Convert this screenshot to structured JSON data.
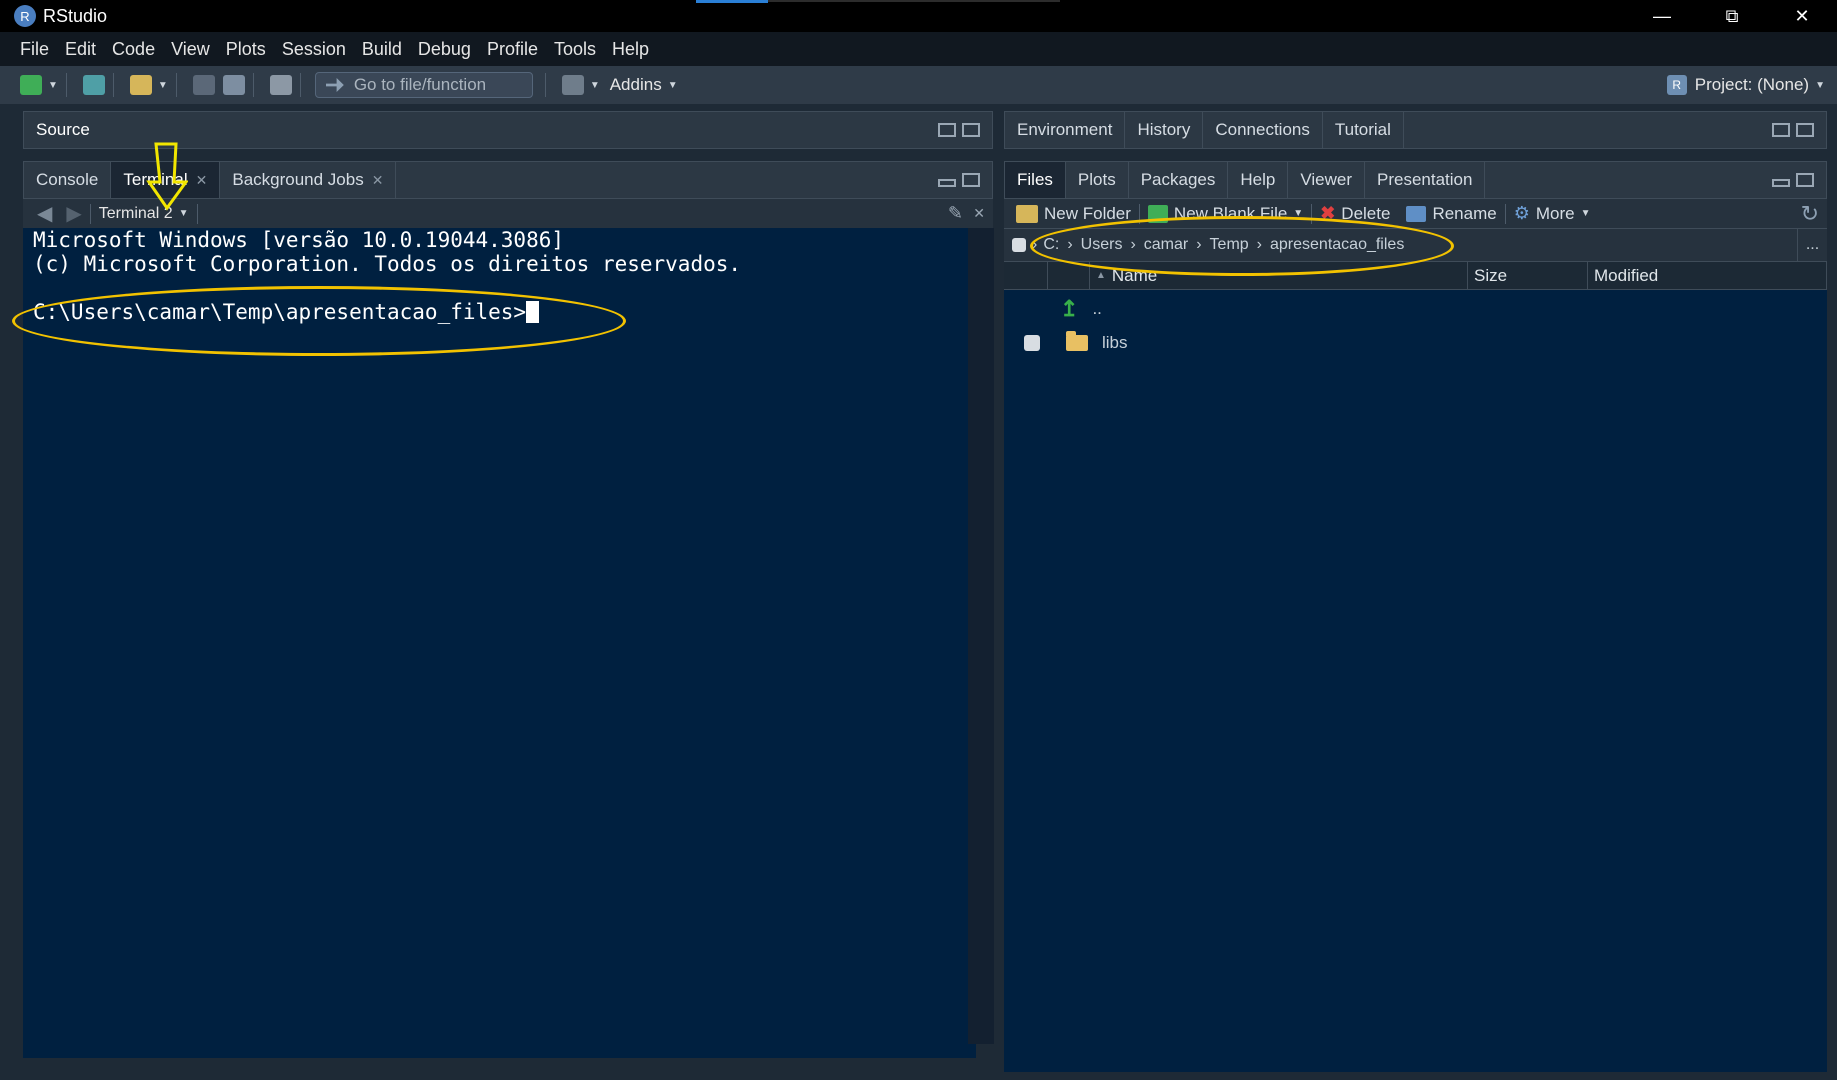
{
  "window": {
    "title": "RStudio",
    "logo_letter": "R"
  },
  "menu": [
    "File",
    "Edit",
    "Code",
    "View",
    "Plots",
    "Session",
    "Build",
    "Debug",
    "Profile",
    "Tools",
    "Help"
  ],
  "toolbar": {
    "goto_placeholder": "Go to file/function",
    "addins_label": "Addins",
    "project_label": "Project: (None)"
  },
  "source_pane": {
    "title": "Source"
  },
  "left_tabs": [
    {
      "label": "Console",
      "active": false
    },
    {
      "label": "Terminal",
      "active": true,
      "closable": true
    },
    {
      "label": "Background Jobs",
      "active": false,
      "closable": true
    }
  ],
  "terminal": {
    "selector_label": "Terminal 2",
    "lines": [
      "Microsoft Windows [versão 10.0.19044.3086]",
      "(c) Microsoft Corporation. Todos os direitos reservados.",
      ""
    ],
    "prompt": "C:\\Users\\camar\\Temp\\apresentacao_files>"
  },
  "right_top_tabs": [
    "Environment",
    "History",
    "Connections",
    "Tutorial"
  ],
  "right_bottom_tabs": [
    {
      "label": "Files",
      "active": true
    },
    {
      "label": "Plots",
      "active": false
    },
    {
      "label": "Packages",
      "active": false
    },
    {
      "label": "Help",
      "active": false
    },
    {
      "label": "Viewer",
      "active": false
    },
    {
      "label": "Presentation",
      "active": false
    }
  ],
  "files_toolbar": {
    "new_folder": "New Folder",
    "new_blank_file": "New Blank File",
    "delete": "Delete",
    "rename": "Rename",
    "more": "More"
  },
  "breadcrumb": [
    "C:",
    "Users",
    "camar",
    "Temp",
    "apresentacao_files"
  ],
  "breadcrumb_more": "...",
  "files_table": {
    "columns": [
      "Name",
      "Size",
      "Modified"
    ],
    "rows": [
      {
        "name": "..",
        "type": "parent"
      },
      {
        "name": "libs",
        "type": "folder"
      }
    ]
  },
  "colors": {
    "terminal_bg": "#002040",
    "annotation": "#f2c200",
    "chrome": "#2c3844"
  },
  "icons": [
    "new-file-icon",
    "new-project-icon",
    "open-folder-icon",
    "save-icon",
    "save-all-icon",
    "print-icon",
    "grid-icon",
    "back-arrow-icon",
    "forward-arrow-icon",
    "broom-icon",
    "close-icon",
    "refresh-icon",
    "gear-icon",
    "up-arrow-icon",
    "folder-icon"
  ]
}
